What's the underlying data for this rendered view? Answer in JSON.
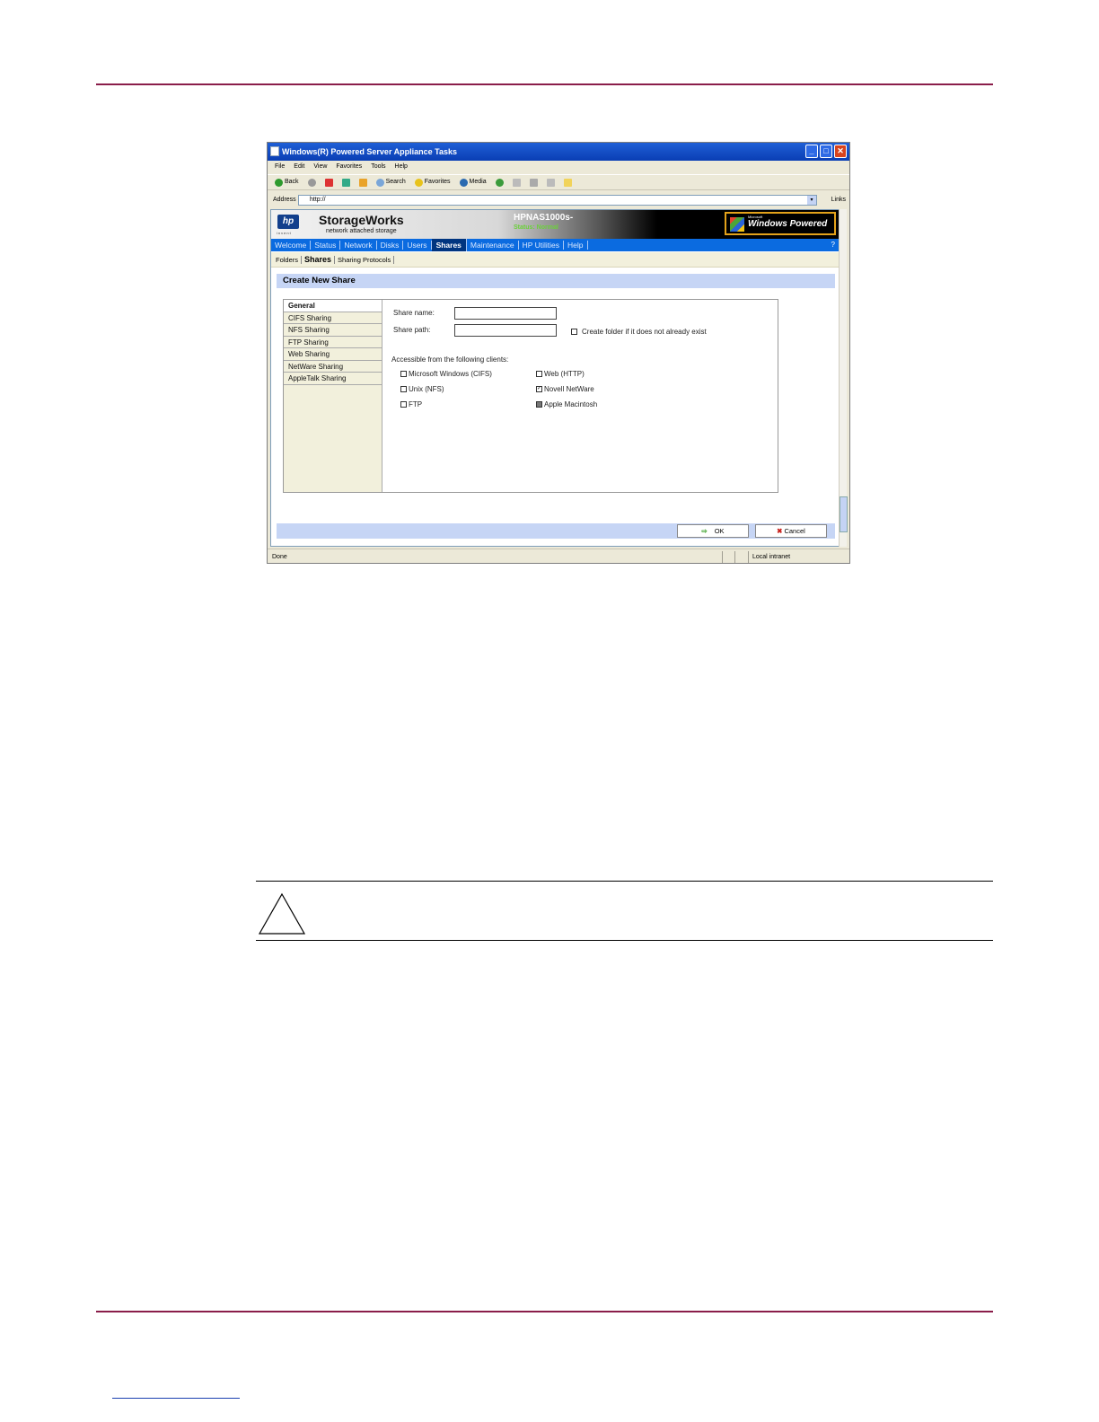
{
  "window": {
    "title": "Windows(R) Powered Server Appliance Tasks",
    "controls": [
      "_",
      "□",
      "✕"
    ]
  },
  "menubar": [
    "File",
    "Edit",
    "View",
    "Favorites",
    "Tools",
    "Help"
  ],
  "toolbar": {
    "back": "Back",
    "search": "Search",
    "favorites": "Favorites",
    "media": "Media"
  },
  "addressbar": {
    "label": "Address",
    "value": "http://",
    "links": "Links"
  },
  "banner": {
    "hp_logo": "hp",
    "hp_sub": "invent",
    "product": "StorageWorks",
    "product_sub": "network attached storage",
    "hostname": "HPNAS1000s-",
    "status": "Status: Normal",
    "ms_label": "Microsoft",
    "windows_powered": "Windows Powered"
  },
  "main_nav": {
    "items": [
      "Welcome",
      "Status",
      "Network",
      "Disks",
      "Users",
      "Shares",
      "Maintenance",
      "HP Utilities",
      "Help"
    ],
    "active": "Shares",
    "help_icon": "?"
  },
  "sub_nav": {
    "items": [
      "Folders",
      "Shares",
      "Sharing Protocols"
    ],
    "active": "Shares"
  },
  "page_title": "Create New Share",
  "side_tabs": [
    "General",
    "CIFS Sharing",
    "NFS Sharing",
    "FTP Sharing",
    "Web Sharing",
    "NetWare Sharing",
    "AppleTalk Sharing"
  ],
  "form": {
    "share_name_label": "Share name:",
    "share_name_value": "",
    "share_path_label": "Share path:",
    "share_path_value": "",
    "create_folder_label": "Create folder if it does not already exist",
    "clients_heading": "Accessible from the following clients:",
    "clients": [
      {
        "label": "Microsoft Windows (CIFS)",
        "state": "unchecked"
      },
      {
        "label": "Web (HTTP)",
        "state": "unchecked"
      },
      {
        "label": "Unix (NFS)",
        "state": "unchecked"
      },
      {
        "label": "Novell NetWare",
        "state": "checked"
      },
      {
        "label": "FTP",
        "state": "unchecked"
      },
      {
        "label": "Apple Macintosh",
        "state": "indeterminate"
      }
    ]
  },
  "buttons": {
    "ok": "OK",
    "cancel": "Cancel"
  },
  "statusbar": {
    "left": "Done",
    "right": "Local intranet"
  },
  "colors": {
    "rule": "#8a1d4a",
    "nav_blue": "#0b6be0",
    "header_band": "#c6d5f5",
    "status_green": "#6bd13a"
  }
}
